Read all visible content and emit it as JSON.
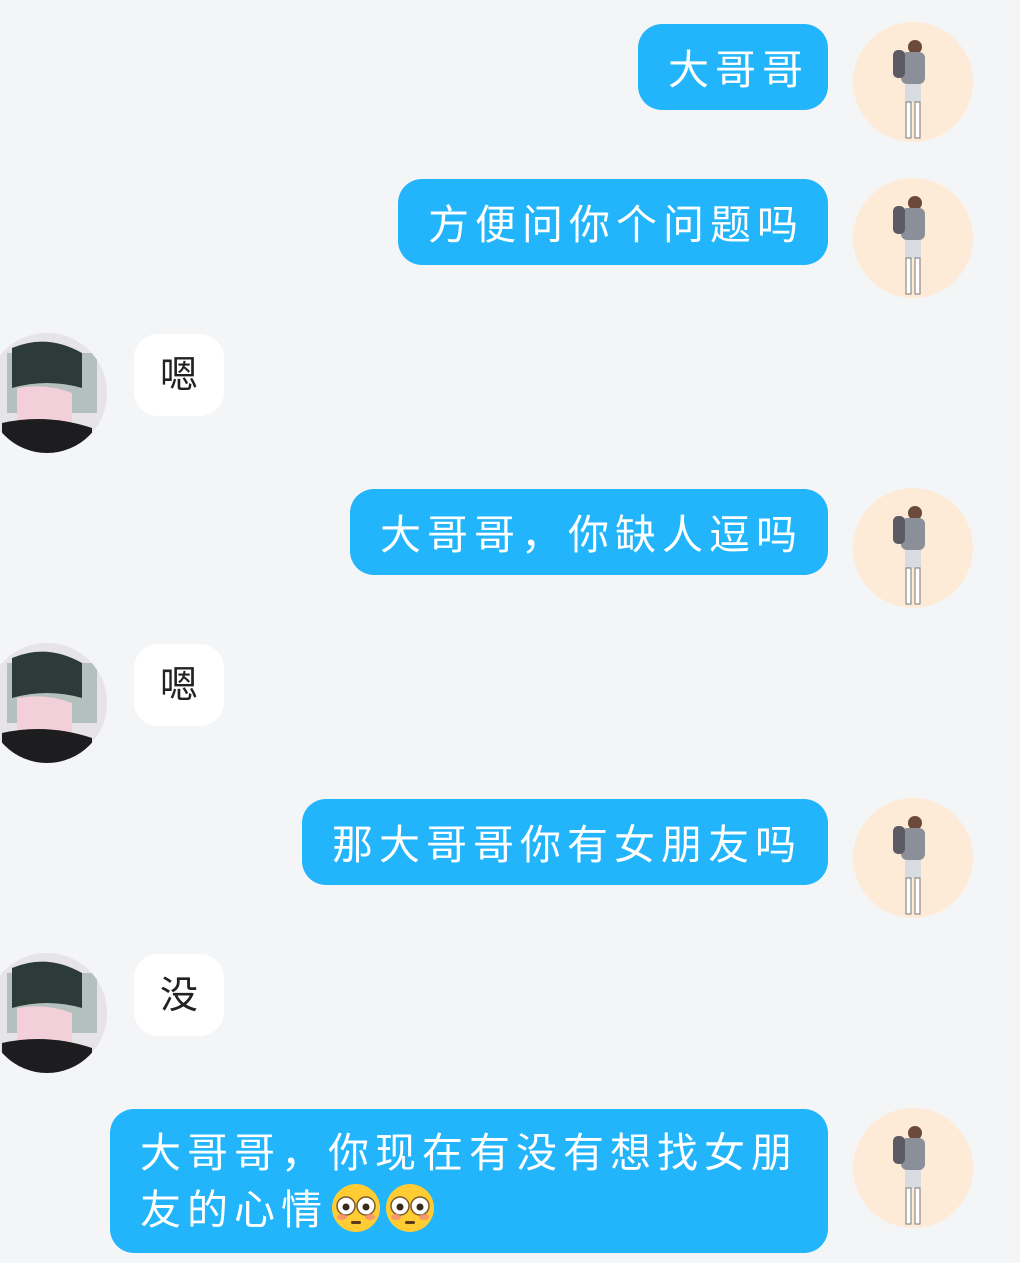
{
  "theme": {
    "background": "#f4f5f7",
    "outgoing_bubble": "#22b5fb",
    "incoming_bubble": "#ffffff"
  },
  "messages": [
    {
      "side": "out",
      "text": "大哥哥"
    },
    {
      "side": "out",
      "text": "方便问你个问题吗"
    },
    {
      "side": "in",
      "text": "嗯"
    },
    {
      "side": "out",
      "text": "大哥哥，你缺人逗吗"
    },
    {
      "side": "in",
      "text": "嗯"
    },
    {
      "side": "out",
      "text": "那大哥哥你有女朋友吗"
    },
    {
      "side": "in",
      "text": "没"
    },
    {
      "side": "out",
      "line1": "大哥哥，你现在有没有想找女朋",
      "line2": "友的心情",
      "emoji": [
        "flushed-face",
        "flushed-face"
      ]
    }
  ],
  "avatars": {
    "self": "anime-girl-avatar",
    "other": "anime-boy-avatar"
  }
}
